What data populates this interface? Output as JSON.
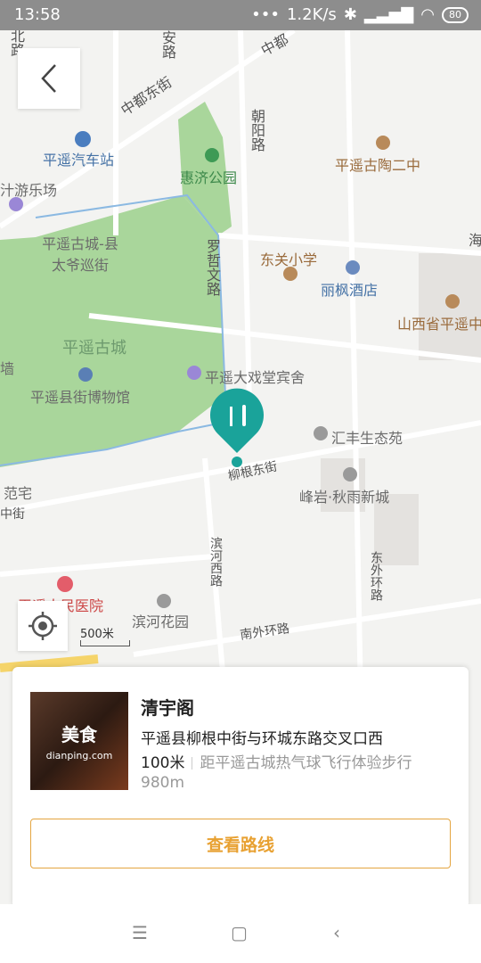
{
  "status": {
    "time": "13:58",
    "speed": "1.2K/s",
    "battery": "80",
    "dots": "•••"
  },
  "map": {
    "labels": {
      "bei": "北路",
      "an": "安路",
      "zhongdu": "中都东街",
      "zhongdu2": "中都",
      "chaoyang": "朝阳路",
      "bus_station": "平遥汽车站",
      "park": "惠济公园",
      "gutao": "平遥古陶二中",
      "leyuan": "汁游乐场",
      "taiye": "平遥古城-县太爷巡街",
      "luozhe": "罗哲文路",
      "dongguan": "东关小学",
      "lifeng": "丽枫酒店",
      "shanxi": "山西省平遥中",
      "hai": "海",
      "ancient_city": "平遥古城",
      "qiang": "墙",
      "museum": "平遥县街博物馆",
      "theatre_hotel": "平遥大戏堂宾舍",
      "huifeng": "汇丰生态苑",
      "liugen": "柳根东街",
      "fanzhai": "范宅",
      "zhongjie": "中街",
      "fengyan": "峰岩·秋雨新城",
      "binhe_road": "滨河西路",
      "dongwai": "东外环路",
      "hospital": "平遥人民医院",
      "binhe_garden": "滨河花园",
      "nanwai": "南外环路"
    },
    "scale": "500米"
  },
  "card": {
    "thumb_title": "美食",
    "thumb_sub": "dianping.com",
    "name": "清宇阁",
    "address": "平遥县柳根中街与环城东路交叉口西",
    "distance": "100米",
    "from_line1": "距平遥古城热气球飞行体验步行",
    "from_line2": "980m",
    "route_button": "查看路线"
  },
  "colors": {
    "accent": "#e8a132",
    "park": "#a8d59a",
    "marker": "#1aa39a"
  }
}
